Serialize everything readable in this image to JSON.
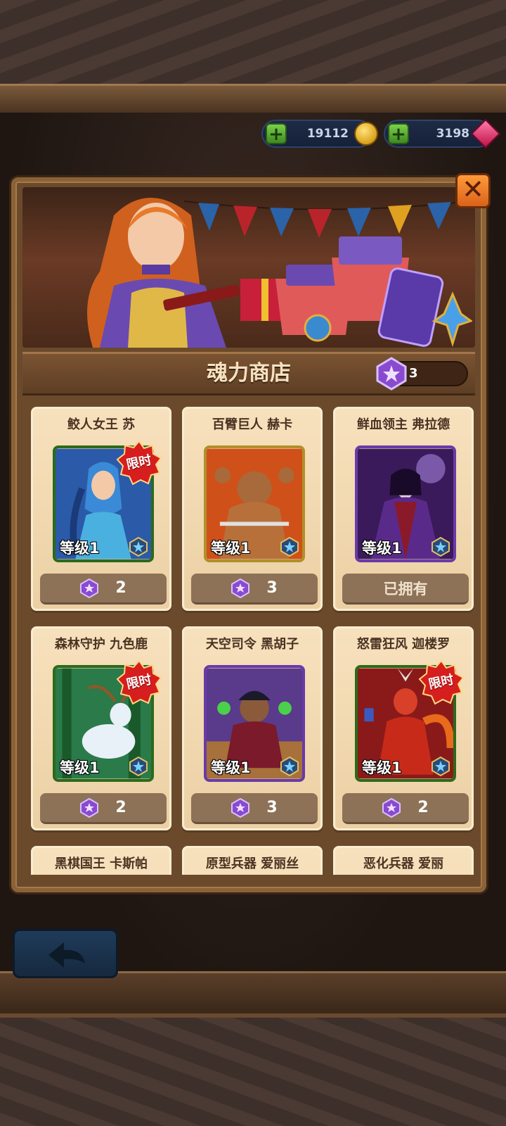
{
  "currency": {
    "gold": "19112",
    "diamonds": "3198"
  },
  "shop": {
    "title": "魂力商店",
    "soul_points": "3"
  },
  "heroes": [
    {
      "name": "鲛人女王 苏",
      "level": "等级1",
      "limited": "限时",
      "price": "2",
      "owned": false,
      "frame": "green"
    },
    {
      "name": "百臂巨人 赫卡",
      "level": "等级1",
      "limited": "",
      "price": "3",
      "owned": false,
      "frame": "gold"
    },
    {
      "name": "鲜血领主 弗拉德",
      "level": "等级1",
      "limited": "",
      "price": "",
      "owned": true,
      "owned_label": "已拥有",
      "frame": "purple"
    },
    {
      "name": "森林守护 九色鹿",
      "level": "等级1",
      "limited": "限时",
      "price": "2",
      "owned": false,
      "frame": "green"
    },
    {
      "name": "天空司令 黑胡子",
      "level": "等级1",
      "limited": "",
      "price": "3",
      "owned": false,
      "frame": "purple"
    },
    {
      "name": "怒雷狂风 迦楼罗",
      "level": "等级1",
      "limited": "限时",
      "price": "2",
      "owned": false,
      "frame": "green"
    },
    {
      "name": "黑棋国王 卡斯帕",
      "level": "",
      "limited": "",
      "price": "",
      "owned": false,
      "frame": "green"
    },
    {
      "name": "原型兵器 爱丽丝",
      "level": "",
      "limited": "",
      "price": "",
      "owned": false,
      "frame": "green"
    },
    {
      "name": "恶化兵器 爱丽",
      "level": "",
      "limited": "",
      "price": "",
      "owned": false,
      "frame": "green"
    }
  ],
  "colors": {
    "panel_wood": "#6b4a2c",
    "card_bg": "#f7e1bd",
    "price_btn": "#8d7258",
    "limited_badge": "#d61e1e",
    "close_btn": "#ff9a3a"
  },
  "icons": [
    "plus-icon",
    "gold-coin-icon",
    "diamond-icon",
    "close-icon",
    "soul-gem-icon",
    "hero-badge-icon",
    "back-arrow-icon"
  ]
}
